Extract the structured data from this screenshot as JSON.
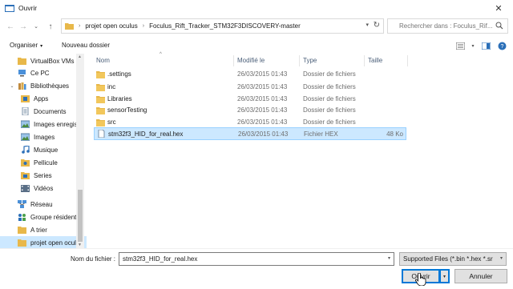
{
  "window": {
    "title": "Ouvrir",
    "close_glyph": "✕"
  },
  "nav": {
    "back_glyph": "←",
    "forward_glyph": "→",
    "history_glyph": "⌄",
    "up_glyph": "↑",
    "breadcrumbs": [
      "projet open oculus",
      "Foculus_Rift_Tracker_STM32F3DISCOVERY-master"
    ],
    "crumb_separator": "›",
    "refresh_glyph": "↻",
    "search_placeholder": "Rechercher dans : Foculus_Rif..."
  },
  "toolbar": {
    "organize_label": "Organiser",
    "organize_caret": "▾",
    "new_folder_label": "Nouveau dossier"
  },
  "sidebar": {
    "items": [
      {
        "label": "VirtualBox VMs",
        "icon": "folder-icon",
        "expand": ""
      },
      {
        "label": "Ce PC",
        "icon": "computer-icon",
        "expand": ""
      },
      {
        "label": "Bibliothèques",
        "icon": "libraries-icon",
        "expand": "⌄"
      },
      {
        "label": "Apps",
        "icon": "apps-icon",
        "expand": ""
      },
      {
        "label": "Documents",
        "icon": "documents-icon",
        "expand": ""
      },
      {
        "label": "Images enregis",
        "icon": "saved-pictures-icon",
        "expand": ""
      },
      {
        "label": "Images",
        "icon": "pictures-icon",
        "expand": ""
      },
      {
        "label": "Musique",
        "icon": "music-icon",
        "expand": ""
      },
      {
        "label": "Pellicule",
        "icon": "camera-roll-icon",
        "expand": ""
      },
      {
        "label": "Series",
        "icon": "series-icon",
        "expand": ""
      },
      {
        "label": "Vidéos",
        "icon": "videos-icon",
        "expand": ""
      },
      {
        "label": "Réseau",
        "icon": "network-icon",
        "expand": ""
      },
      {
        "label": "Groupe résident",
        "icon": "homegroup-icon",
        "expand": ""
      },
      {
        "label": "A trier",
        "icon": "folder-icon",
        "expand": ""
      },
      {
        "label": "projet open ocul",
        "icon": "folder-icon",
        "expand": "⌄"
      }
    ]
  },
  "files": {
    "columns": {
      "name": "Nom",
      "date": "Modifié le",
      "type": "Type",
      "size": "Taille"
    },
    "sort_caret": "^",
    "rows": [
      {
        "name": ".settings",
        "date": "26/03/2015 01:43",
        "type": "Dossier de fichiers",
        "size": "",
        "icon": "folder-icon"
      },
      {
        "name": "inc",
        "date": "26/03/2015 01:43",
        "type": "Dossier de fichiers",
        "size": "",
        "icon": "folder-icon"
      },
      {
        "name": "Libraries",
        "date": "26/03/2015 01:43",
        "type": "Dossier de fichiers",
        "size": "",
        "icon": "folder-icon"
      },
      {
        "name": "sensorTesting",
        "date": "26/03/2015 01:43",
        "type": "Dossier de fichiers",
        "size": "",
        "icon": "folder-icon"
      },
      {
        "name": "src",
        "date": "26/03/2015 01:43",
        "type": "Dossier de fichiers",
        "size": "",
        "icon": "folder-icon"
      },
      {
        "name": "stm32f3_HID_for_real.hex",
        "date": "26/03/2015 01:43",
        "type": "Fichier HEX",
        "size": "48 Ko",
        "icon": "file-icon"
      }
    ]
  },
  "footer": {
    "filename_label": "Nom du fichier :",
    "filename_value": "stm32f3_HID_for_real.hex",
    "filter_value": "Supported Files (*.bin *.hex *.sr",
    "open_label": "Ouvrir",
    "cancel_label": "Annuler"
  },
  "colors": {
    "selection": "#cce8ff",
    "folder": "#e8b84a",
    "accent": "#0078d7"
  }
}
